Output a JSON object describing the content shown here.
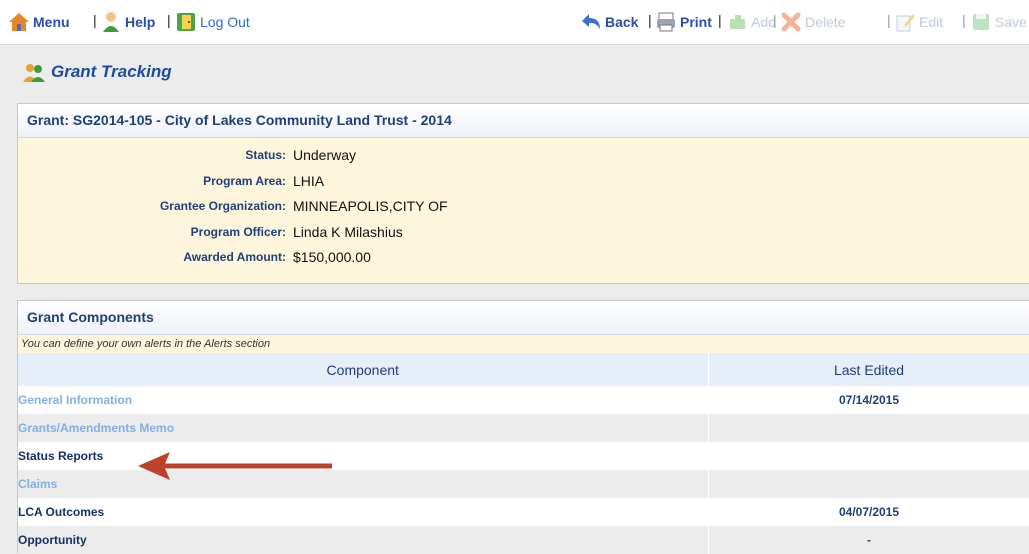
{
  "toolbar": {
    "menu": "Menu",
    "help": "Help",
    "logout": "Log Out",
    "back": "Back",
    "print": "Print",
    "add": "Add",
    "delete": "Delete",
    "edit": "Edit",
    "save": "Save",
    "separator": "|"
  },
  "page": {
    "title": "Grant Tracking"
  },
  "grant": {
    "heading": "Grant: SG2014-105 - City of Lakes Community Land Trust - 2014",
    "fields": [
      {
        "label": "Status:",
        "value": "Underway"
      },
      {
        "label": "Program Area:",
        "value": "LHIA"
      },
      {
        "label": "Grantee Organization:",
        "value": "MINNEAPOLIS,CITY OF"
      },
      {
        "label": "Program Officer:",
        "value": "Linda K Milashius"
      },
      {
        "label": "Awarded Amount:",
        "value": "$150,000.00"
      }
    ]
  },
  "components": {
    "heading": "Grant Components",
    "hint": "You can define your own alerts in the Alerts section",
    "columns": [
      "Component",
      "Last Edited"
    ],
    "rows": [
      {
        "name": "General Information",
        "date": "07/14/2015"
      },
      {
        "name": "Grants/Amendments Memo",
        "date": ""
      },
      {
        "name": "Status Reports",
        "date": ""
      },
      {
        "name": "Claims",
        "date": ""
      },
      {
        "name": "LCA Outcomes",
        "date": "04/07/2015"
      },
      {
        "name": "Opportunity",
        "date": "-"
      }
    ]
  },
  "colors": {
    "accent": "#1f3f78",
    "link_light": "#7fb0e6",
    "panel_bg": "#fdf6dc",
    "arrow": "#c0412b"
  },
  "icons": {
    "menu": "house-icon",
    "help": "help-person-icon",
    "logout": "logout-door-icon",
    "back": "back-arrow-icon",
    "print": "printer-icon",
    "add": "add-puzzle-icon",
    "delete": "delete-x-icon",
    "edit": "edit-pencil-icon",
    "save": "save-disk-icon",
    "title": "grant-people-icon"
  }
}
